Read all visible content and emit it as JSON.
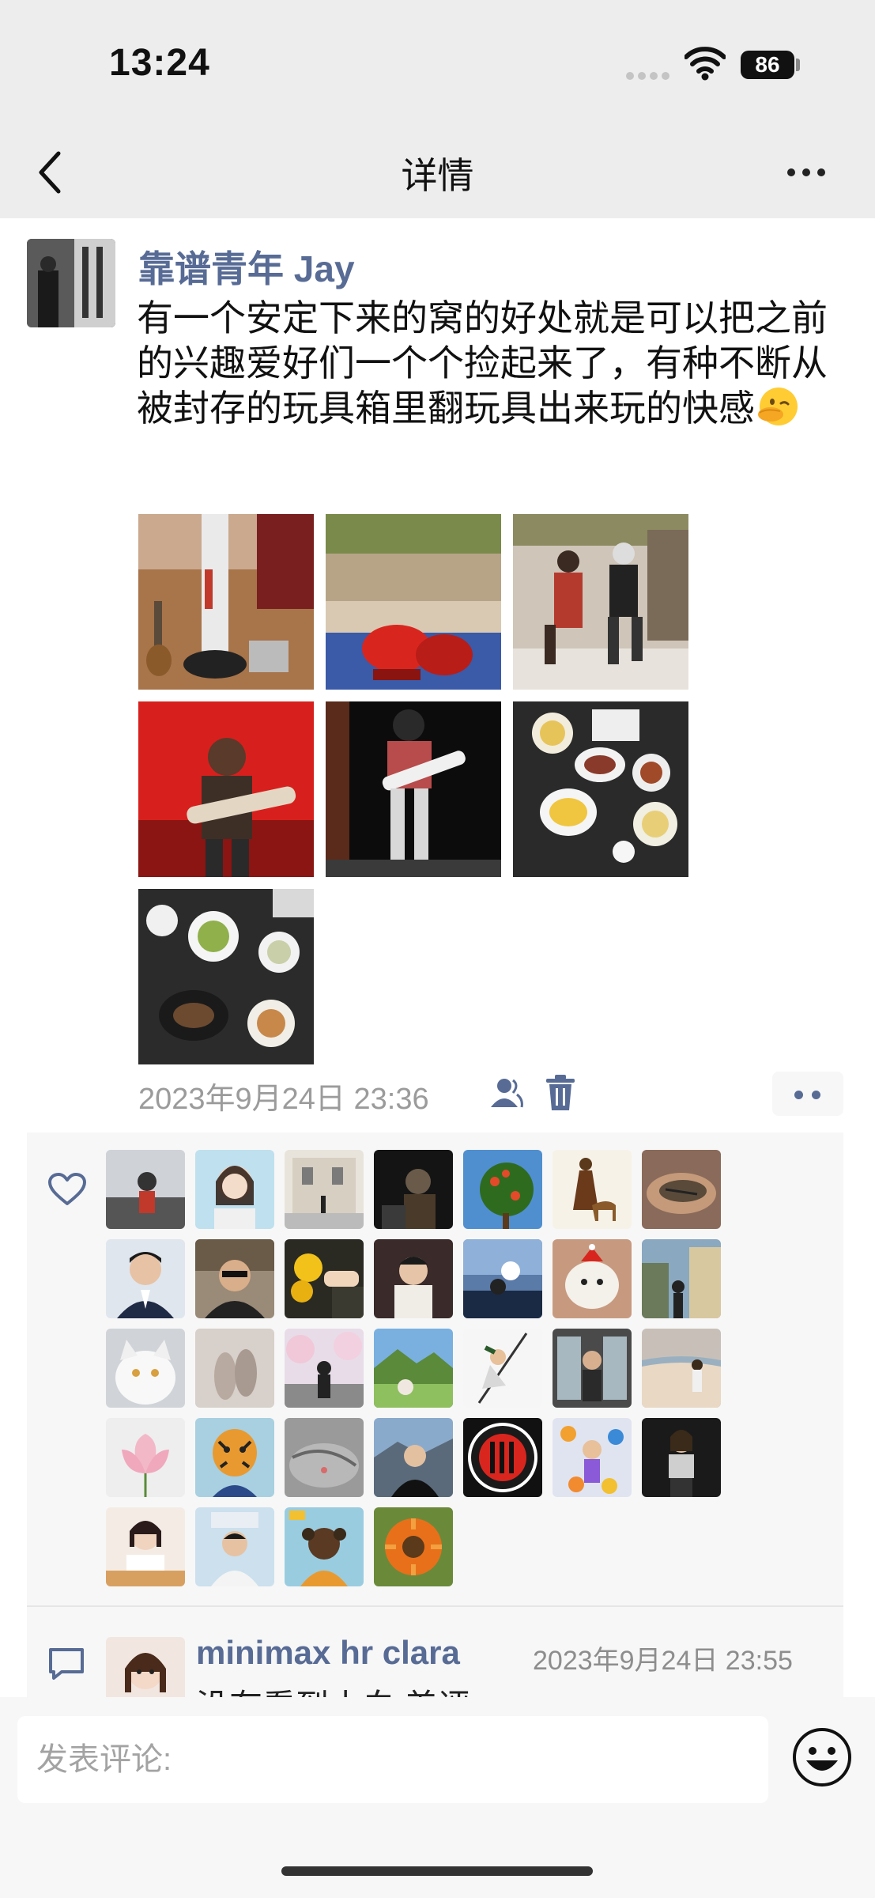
{
  "status_bar": {
    "time": "13:24",
    "battery": "86"
  },
  "nav": {
    "title": "详情"
  },
  "post": {
    "author": "靠谱青年 Jay",
    "text": "有一个安定下来的窝的好处就是可以把之前的兴趣爱好们一个个捡起来了，有种不断从被封存的玩具箱里翻玩具出来玩的快感",
    "emoji_icon": "face-with-hand-over-mouth-emoji",
    "photo_count": 7,
    "timestamp": "2023年9月24日 23:36"
  },
  "likes": {
    "count": 33,
    "icon": "heart-outline-icon"
  },
  "comments": [
    {
      "author": "minimax hr clara",
      "time": "2023年9月24日 23:55",
      "text": "没有看到小白 差评"
    }
  ],
  "comment_input": {
    "placeholder": "发表评论:"
  },
  "colors": {
    "link": "#576b95",
    "nav_bg": "#ededed",
    "panel_bg": "#f7f7f7",
    "meta_gray": "#9b9b9b"
  }
}
